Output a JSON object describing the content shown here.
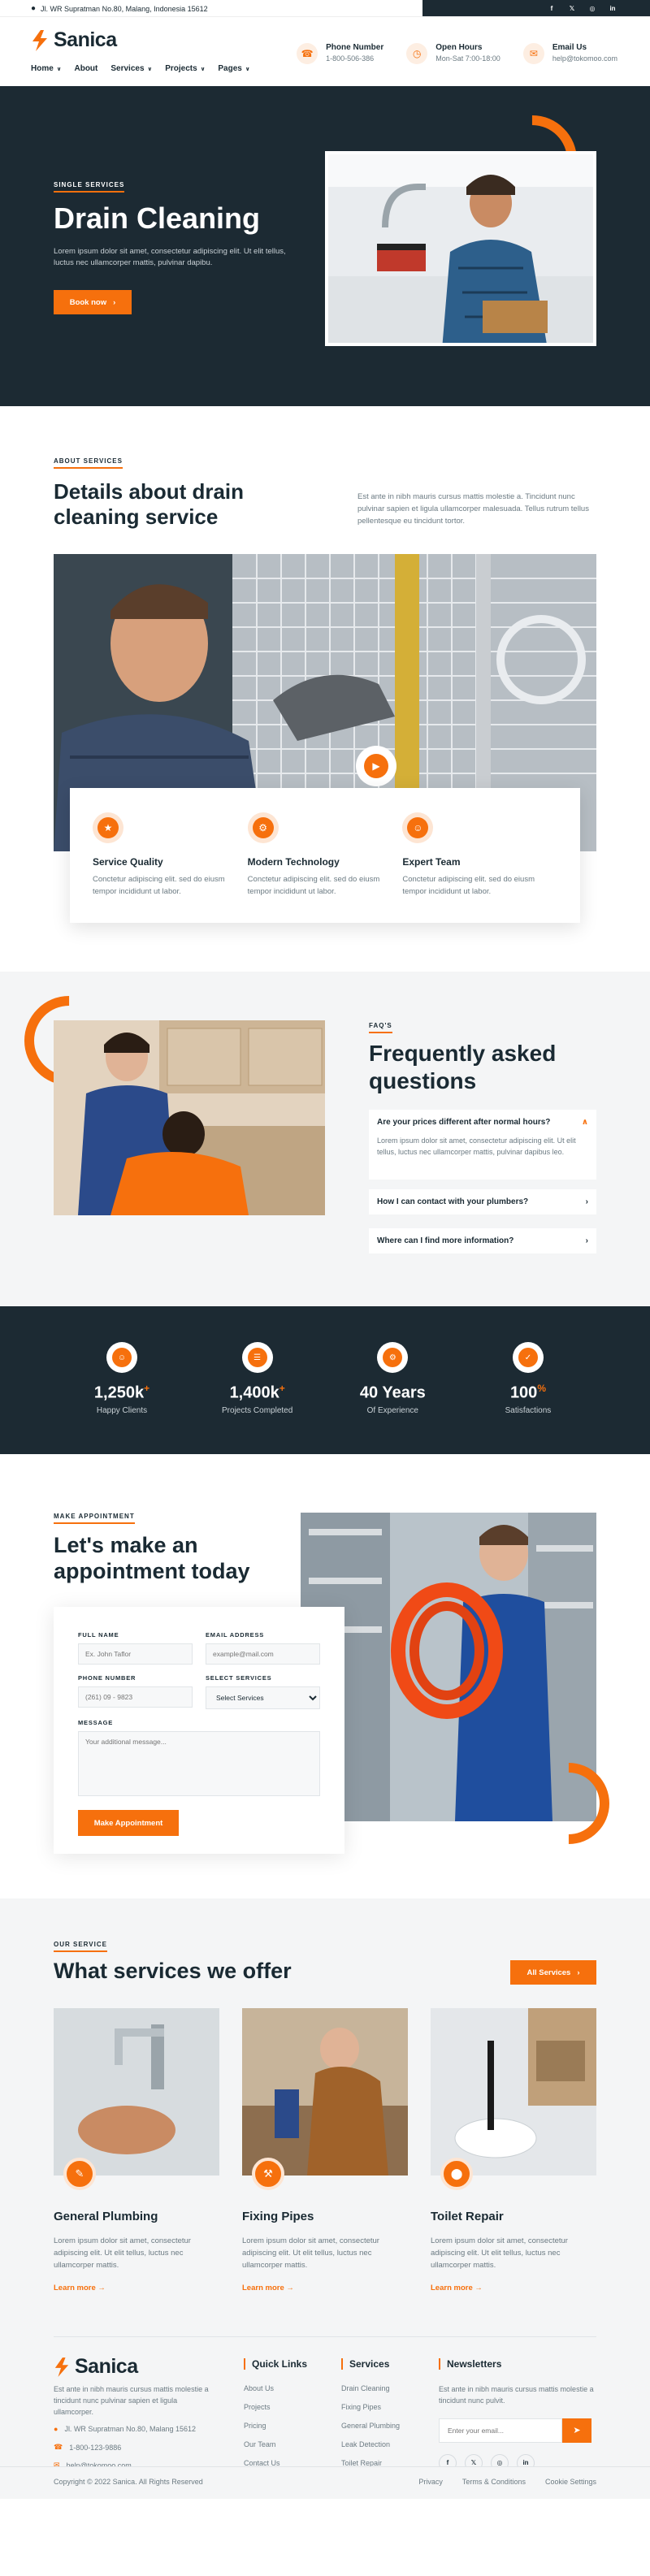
{
  "topbar": {
    "address": "Jl. WR Supratman No.80, Malang, Indonesia 15612",
    "social": [
      "f-icon",
      "twitter-icon",
      "instagram-icon",
      "linkedin-icon"
    ]
  },
  "brand": {
    "name": "Sanica",
    "accent": "#f6700d",
    "dark": "#1c2a33"
  },
  "nav": [
    {
      "label": "Home",
      "dropdown": true
    },
    {
      "label": "About",
      "dropdown": false
    },
    {
      "label": "Services",
      "dropdown": true
    },
    {
      "label": "Projects",
      "dropdown": true
    },
    {
      "label": "Pages",
      "dropdown": true
    }
  ],
  "contacts": [
    {
      "title": "Phone Number",
      "value": "1-800-506-386",
      "icon": "phone-icon"
    },
    {
      "title": "Open Hours",
      "value": "Mon-Sat 7:00-18:00",
      "icon": "clock-icon"
    },
    {
      "title": "Email Us",
      "value": "help@tokomoo.com",
      "icon": "mail-icon"
    }
  ],
  "hero": {
    "tag": "SINGLE SERVICES",
    "title": "Drain Cleaning",
    "text": "Lorem ipsum dolor sit amet, consectetur adipiscing elit. Ut elit tellus, luctus nec ullamcorper mattis, pulvinar dapibu.",
    "button": "Book now"
  },
  "about": {
    "tag": "ABOUT SERVICES",
    "title": "Details about drain cleaning service",
    "text": "Est ante in nibh mauris cursus mattis molestie a. Tincidunt nunc pulvinar sapien et ligula ullamcorper malesuada. Tellus rutrum tellus pellentesque eu tincidunt tortor.",
    "features": [
      {
        "title": "Service Quality",
        "text": "Conctetur adipiscing elit. sed do eiusm tempor incididunt ut labor.",
        "icon": "quality-icon"
      },
      {
        "title": "Modern Technology",
        "text": "Conctetur adipiscing elit. sed do eiusm tempor incididunt ut labor.",
        "icon": "tech-icon"
      },
      {
        "title": "Expert Team",
        "text": "Conctetur adipiscing elit. sed do eiusm tempor incididunt ut labor.",
        "icon": "team-icon"
      }
    ]
  },
  "faq": {
    "tag": "FAQ'S",
    "title": "Frequently asked questions",
    "items": [
      {
        "q": "Are your prices different after normal hours?",
        "a": "Lorem ipsum dolor sit amet, consectetur adipiscing elit. Ut elit tellus, luctus nec ullamcorper mattis, pulvinar dapibus leo.",
        "open": true
      },
      {
        "q": "How I can contact with your plumbers?",
        "open": false
      },
      {
        "q": "Where can I find more information?",
        "open": false
      }
    ]
  },
  "stats": [
    {
      "num": "1,250k",
      "sup": "+",
      "label": "Happy Clients",
      "icon": "clients-icon"
    },
    {
      "num": "1,400k",
      "sup": "+",
      "label": "Projects Completed",
      "icon": "projects-icon"
    },
    {
      "num": "40 Years",
      "sup": "",
      "label": "Of Experience",
      "icon": "experience-icon"
    },
    {
      "num": "100",
      "sup": "%",
      "label": "Satisfactions",
      "icon": "satisfaction-icon"
    }
  ],
  "appointment": {
    "tag": "MAKE APPOINTMENT",
    "title": "Let's make an appointment today",
    "labels": {
      "name": "FULL NAME",
      "email": "EMAIL ADDRESS",
      "phone": "PHONE NUMBER",
      "service": "SELECT SERVICES",
      "message": "MESSAGE"
    },
    "placeholders": {
      "name": "Ex. John Taflor",
      "email": "example@mail.com",
      "phone": "(261) 09 - 9823",
      "message": "Your additional message..."
    },
    "service_value": "Select Services",
    "button": "Make Appointment"
  },
  "services": {
    "tag": "OUR SERVICE",
    "title": "What services we offer",
    "button": "All Services",
    "items": [
      {
        "title": "General Plumbing",
        "text": "Lorem ipsum dolor sit amet, consectetur adipiscing elit. Ut elit tellus, luctus nec ullamcorper mattis.",
        "more": "Learn more"
      },
      {
        "title": "Fixing Pipes",
        "text": "Lorem ipsum dolor sit amet, consectetur adipiscing elit. Ut elit tellus, luctus nec ullamcorper mattis.",
        "more": "Learn more"
      },
      {
        "title": "Toilet Repair",
        "text": "Lorem ipsum dolor sit amet, consectetur adipiscing elit. Ut elit tellus, luctus nec ullamcorper mattis.",
        "more": "Learn more"
      }
    ]
  },
  "footer": {
    "about": "Est ante in nibh mauris cursus mattis molestie a tincidunt nunc pulvinar sapien et ligula ullamcorper.",
    "address": "Jl. WR Supratman No.80, Malang 15612",
    "phone": "1-800-123-9886",
    "email": "help@tokomoo.com",
    "quick_title": "Quick Links",
    "quick": [
      "About Us",
      "Projects",
      "Pricing",
      "Our Team",
      "Contact Us"
    ],
    "services_title": "Services",
    "services": [
      "Drain Cleaning",
      "Fixing Pipes",
      "General Plumbing",
      "Leak Detection",
      "Toilet Repair"
    ],
    "news_title": "Newsletters",
    "news_text": "Est ante in nibh mauris cursus mattis molestie a tincidunt nunc pulvit.",
    "news_placeholder": "Enter your email...",
    "copyright": "Copyright © 2022 Sanica. All Rights Reserved",
    "legal": [
      "Privacy",
      "Terms & Conditions",
      "Cookie Settings"
    ]
  }
}
